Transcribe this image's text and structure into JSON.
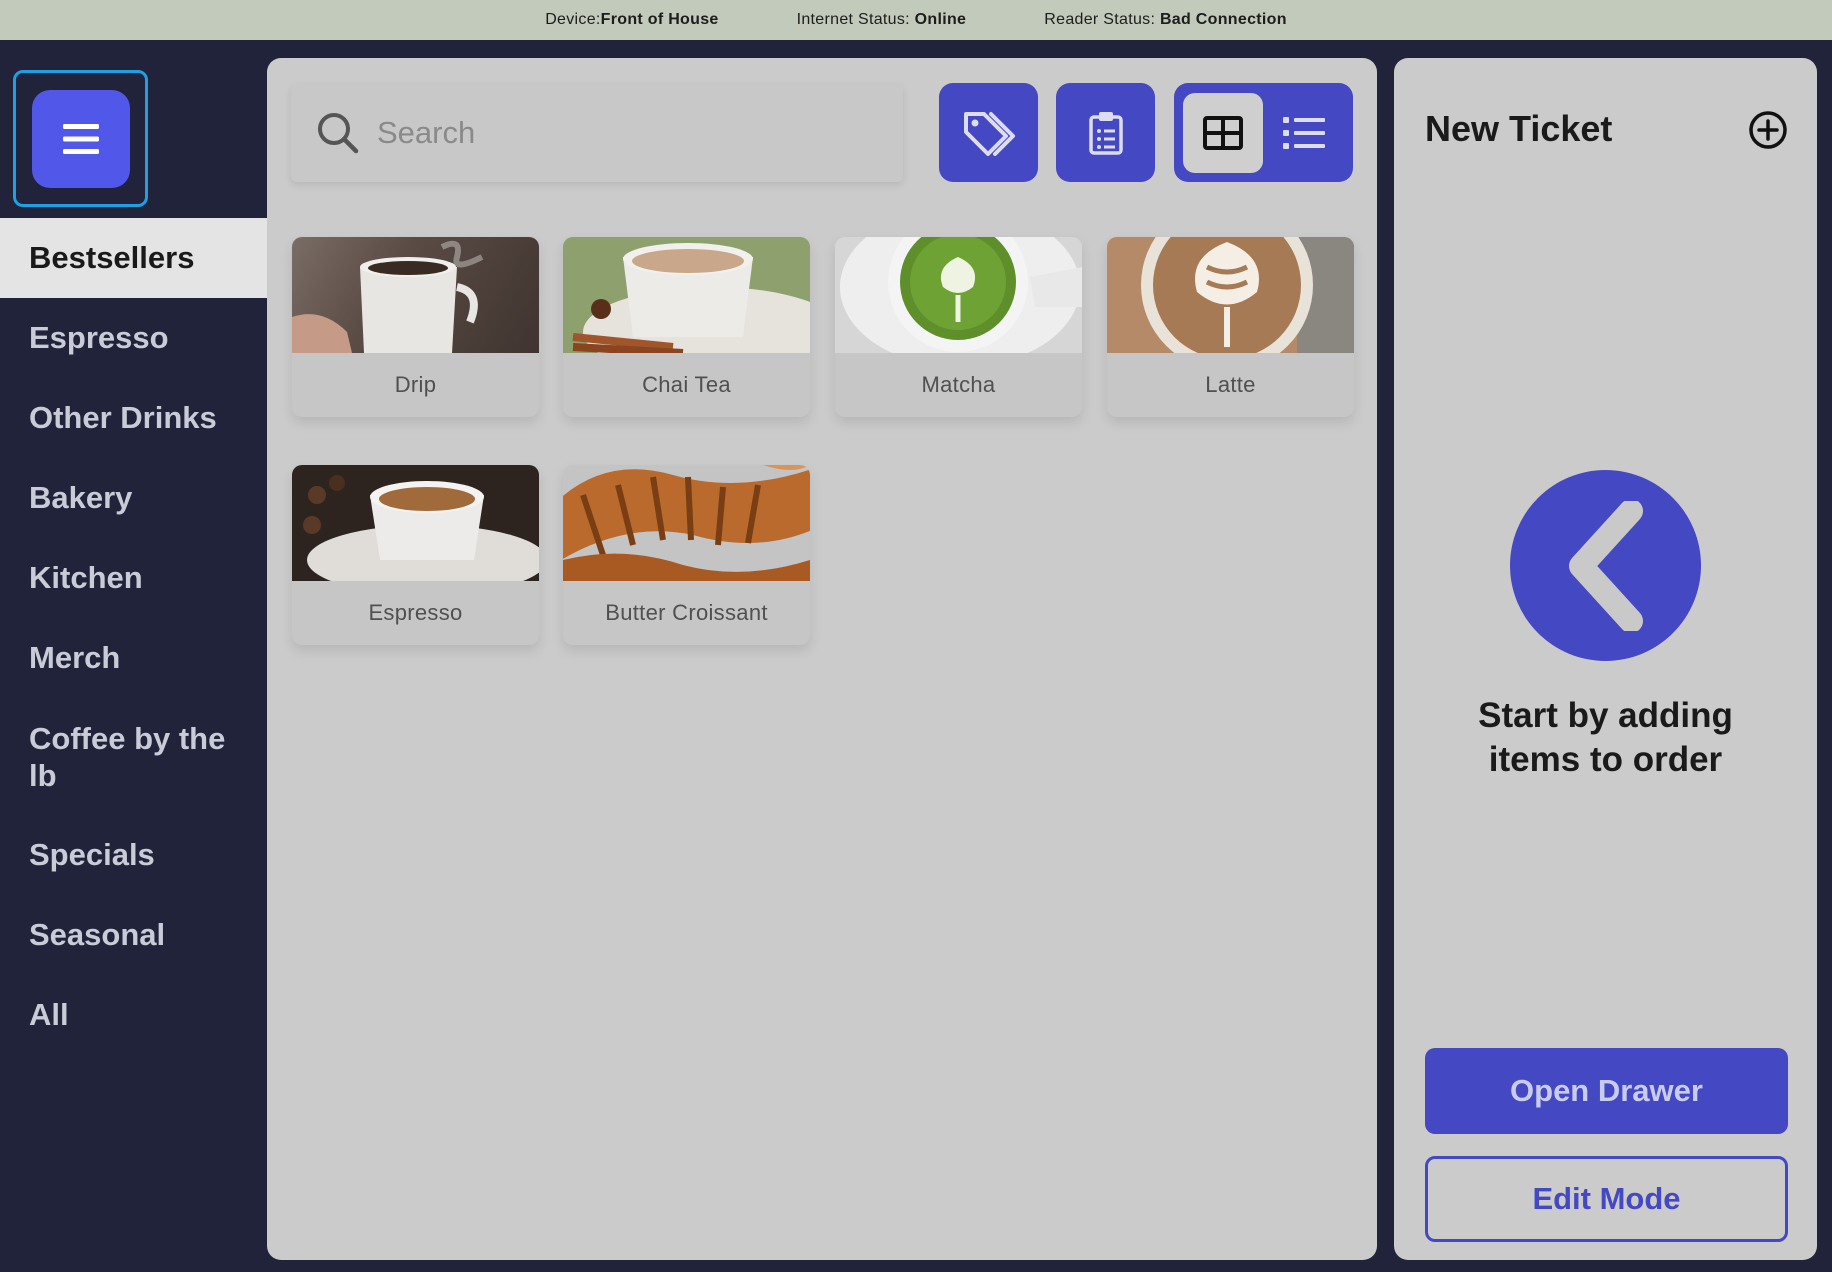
{
  "status_bar": {
    "device_label": "Device:",
    "device_value": "Front of House",
    "internet_label": "Internet Status: ",
    "internet_value": "Online",
    "reader_label": "Reader Status: ",
    "reader_value": "Bad Connection"
  },
  "sidebar": {
    "menu_icon": "hamburger-menu-icon",
    "categories": [
      {
        "label": "Bestsellers",
        "active": true
      },
      {
        "label": "Espresso"
      },
      {
        "label": "Other Drinks"
      },
      {
        "label": "Bakery"
      },
      {
        "label": "Kitchen"
      },
      {
        "label": "Merch"
      },
      {
        "label": "Coffee by the lb"
      },
      {
        "label": "Specials"
      },
      {
        "label": "Seasonal"
      },
      {
        "label": "All"
      }
    ]
  },
  "main": {
    "search": {
      "placeholder": "Search",
      "value": ""
    },
    "toolbar": {
      "discount_icon": "tags-icon",
      "orders_icon": "clipboard-list-icon",
      "grid_view_icon": "grid-icon",
      "list_view_icon": "list-icon",
      "active_view": "grid"
    },
    "items": [
      {
        "name": "Drip"
      },
      {
        "name": "Chai Tea"
      },
      {
        "name": "Matcha"
      },
      {
        "name": "Latte"
      },
      {
        "name": "Espresso"
      },
      {
        "name": "Butter Croissant"
      }
    ]
  },
  "ticket": {
    "title": "New Ticket",
    "add_icon": "plus-circle-icon",
    "empty_icon": "chevron-left-icon",
    "empty_message": "Start by adding items to order",
    "open_drawer_label": "Open Drawer",
    "edit_mode_label": "Edit Mode"
  },
  "colors": {
    "accent": "#4448c3",
    "menu_button": "#5157e8",
    "sidebar_bg": "#20233a",
    "status_bar_bg": "#c2cabb",
    "focus_ring": "#1ea0e3"
  }
}
